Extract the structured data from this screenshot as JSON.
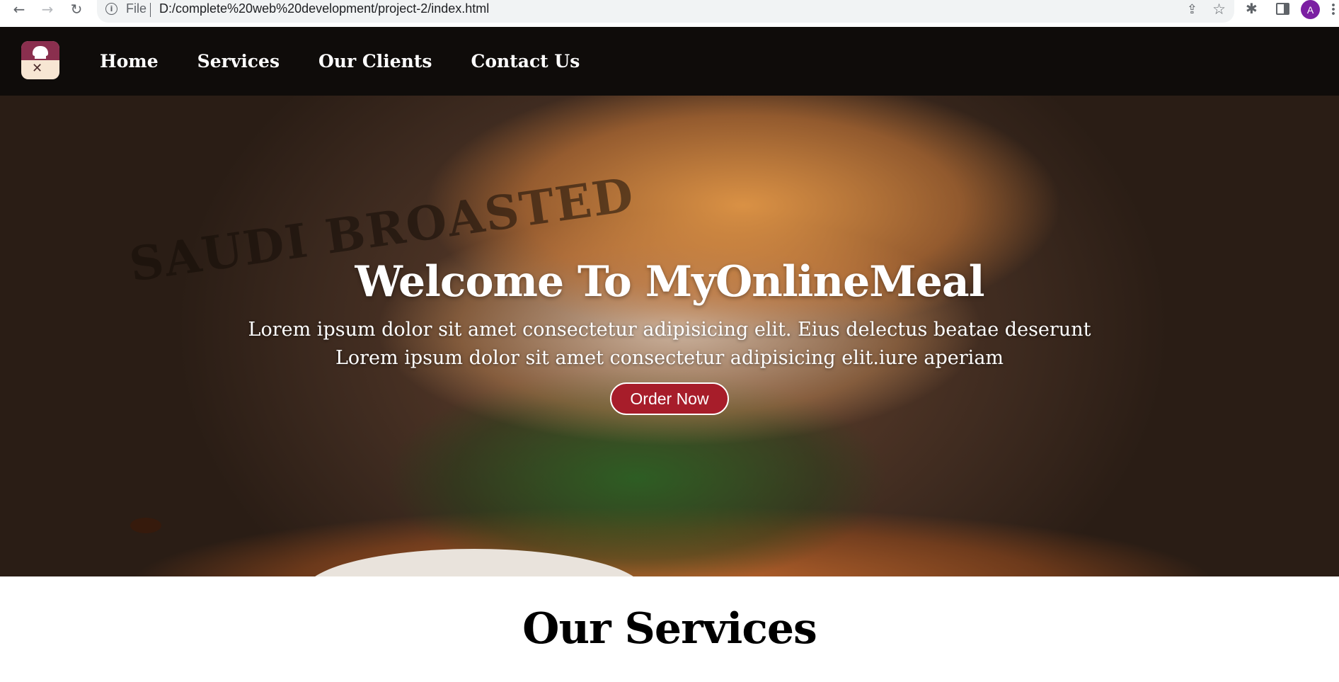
{
  "browser": {
    "back_icon": "←",
    "forward_icon": "→",
    "reload_icon": "↻",
    "info_icon": "i",
    "scheme": "File",
    "url": "D:/complete%20web%20development/project-2/index.html",
    "share_icon": "⇪",
    "star_icon": "☆",
    "extensions_icon": "✱",
    "profile_initial": "A"
  },
  "nav": {
    "logo_utensils": "✕",
    "links": [
      {
        "label": "Home"
      },
      {
        "label": "Services"
      },
      {
        "label": "Our Clients"
      },
      {
        "label": "Contact Us"
      }
    ]
  },
  "hero": {
    "background_watermark": "SAUDI BROASTED",
    "title": "Welcome To MyOnlineMeal",
    "line1": "Lorem ipsum dolor sit amet consectetur adipisicing elit. Eius delectus beatae deserunt",
    "line2": "Lorem ipsum dolor sit amet consectetur adipisicing elit.iure aperiam",
    "button_label": "Order Now"
  },
  "services": {
    "title": "Our Services"
  },
  "colors": {
    "nav_bg": "#0f0c0a",
    "button_bg": "#a71d2a",
    "logo_top": "#8a2f4e",
    "avatar": "#7b1fa2"
  }
}
